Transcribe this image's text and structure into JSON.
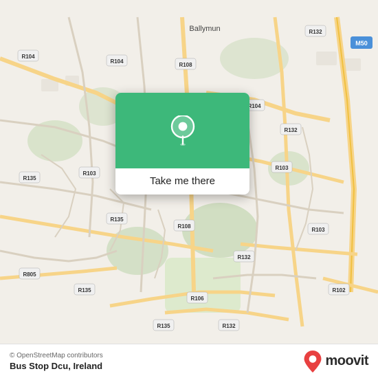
{
  "map": {
    "attribution": "© OpenStreetMap contributors",
    "location": "Bus Stop Dcu, Ireland"
  },
  "popup": {
    "button_label": "Take me there",
    "pin_icon": "location-pin"
  },
  "branding": {
    "moovit_text": "moovit"
  },
  "road_labels": [
    "R132",
    "M50",
    "R104",
    "R108",
    "R104",
    "R132",
    "R135",
    "R103",
    "R103",
    "R135",
    "R108",
    "R103",
    "R103",
    "R805",
    "R135",
    "R106",
    "R132",
    "R135",
    "R102",
    "Ballymun"
  ],
  "colors": {
    "map_bg": "#f2efe9",
    "road_primary": "#f7d488",
    "road_secondary": "#e8e0cc",
    "green_area": "#c8dab8",
    "popup_green": "#3db87a",
    "moovit_red": "#e84040"
  }
}
